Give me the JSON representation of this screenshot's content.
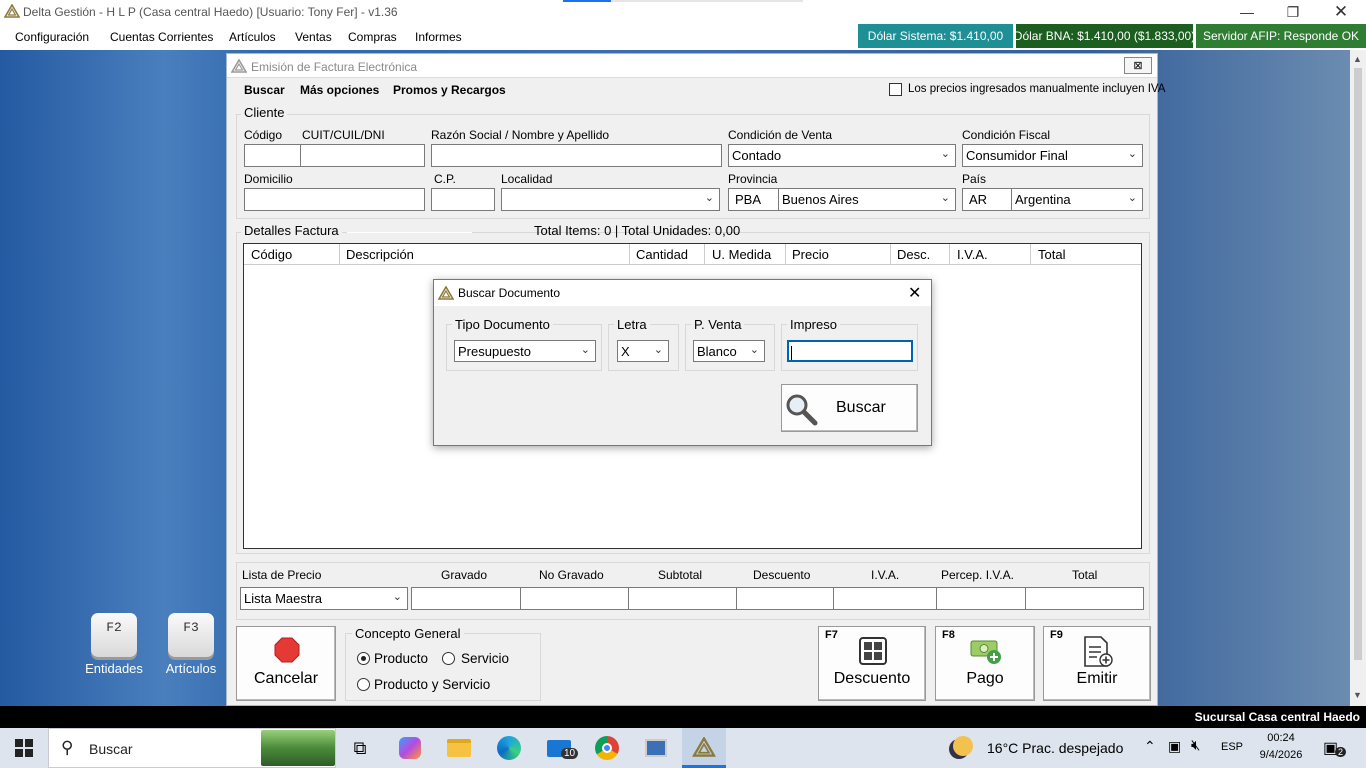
{
  "app": {
    "title": "Delta Gestión - H L P (Casa central Haedo) [Usuario: Tony Fer] - v1.36",
    "menu": [
      "Configuración",
      "Cuentas Corrientes",
      "Artículos",
      "Ventas",
      "Compras",
      "Informes"
    ],
    "status_pills": {
      "dolar_sistema": "Dólar Sistema: $1.410,00",
      "dolar_bna": "Dólar BNA: $1.410,00 ($1.833,00)",
      "afip": "Servidor AFIP:  Responde OK"
    },
    "colors": {
      "teal_pill": "#1f8f96",
      "green_pill": "#1b5e20",
      "afip_pill": "#2e7d32"
    }
  },
  "desktop_icons": [
    {
      "key": "F2",
      "label": "Entidades"
    },
    {
      "key": "F3",
      "label": "Artículos"
    }
  ],
  "invoice": {
    "title": "Emisión de Factura Electrónica",
    "close": "⊠",
    "toolbar": {
      "buscar": "Buscar",
      "mas_opciones": "Más opciones",
      "promos": "Promos y Recargos"
    },
    "precios_iva_label": "Los precios ingresados manualmente incluyen IVA",
    "cliente": {
      "group_label": "Cliente",
      "codigo_label": "Código",
      "cuit_label": "CUIT/CUIL/DNI",
      "razon_label": "Razón Social / Nombre y Apellido",
      "condicion_venta_label": "Condición de Venta",
      "condicion_venta_value": "Contado",
      "condicion_fiscal_label": "Condición Fiscal",
      "condicion_fiscal_value": "Consumidor Final",
      "domicilio_label": "Domicilio",
      "cp_label": "C.P.",
      "localidad_label": "Localidad",
      "provincia_label": "Provincia",
      "provincia_code": "PBA",
      "provincia_value": "Buenos Aires",
      "pais_label": "País",
      "pais_code": "AR",
      "pais_value": "Argentina"
    },
    "detalles": {
      "group_label": "Detalles Factura",
      "totals_text": "Total Items: 0 | Total Unidades: 0,00",
      "columns": [
        "Código",
        "Descripción",
        "Cantidad",
        "U. Medida",
        "Precio",
        "Desc.",
        "I.V.A.",
        "Total"
      ]
    },
    "footer": {
      "lista_precio_label": "Lista de Precio",
      "lista_precio_value": "Lista Maestra",
      "gravado": "Gravado",
      "no_gravado": "No Gravado",
      "subtotal": "Subtotal",
      "descuento": "Descuento",
      "iva": "I.V.A.",
      "percep": "Percep. I.V.A.",
      "total": "Total"
    },
    "cancelar_label": "Cancelar",
    "concepto": {
      "group_label": "Concepto General",
      "producto": "Producto",
      "servicio": "Servicio",
      "producto_servicio": "Producto y Servicio"
    },
    "actions": [
      {
        "key": "F7",
        "label": "Descuento"
      },
      {
        "key": "F8",
        "label": "Pago"
      },
      {
        "key": "F9",
        "label": "Emitir"
      }
    ]
  },
  "dialog": {
    "title": "Buscar Documento",
    "tipo_label": "Tipo Documento",
    "tipo_value": "Presupuesto",
    "letra_label": "Letra",
    "letra_value": "X",
    "pventa_label": "P. Venta",
    "pventa_value": "Blanco",
    "impreso_label": "Impreso",
    "impreso_value": "",
    "buscar_label": "Buscar"
  },
  "statusbar": {
    "sucursal": "Sucursal Casa central Haedo"
  },
  "taskbar": {
    "search_placeholder": "Buscar",
    "mail_badge": "10",
    "weather": "16°C  Prac. despejado",
    "lang": "ESP",
    "time": "00:24",
    "date": "9/4/2026",
    "notif_count": "2"
  }
}
